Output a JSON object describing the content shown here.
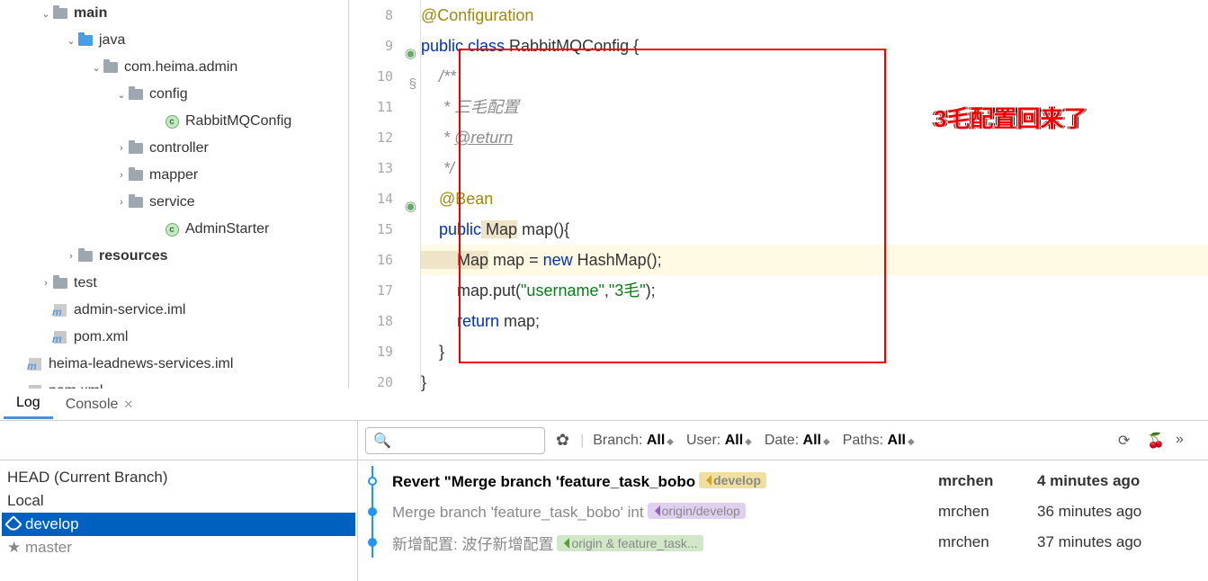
{
  "tree": [
    {
      "indent": 44,
      "arrow": "v",
      "icon": "folder",
      "label": "main",
      "bold": true
    },
    {
      "indent": 72,
      "arrow": "v",
      "icon": "folder-blue",
      "label": "java",
      "bold": false
    },
    {
      "indent": 100,
      "arrow": "v",
      "icon": "folder",
      "label": "com.heima.admin",
      "bold": false
    },
    {
      "indent": 128,
      "arrow": "v",
      "icon": "folder",
      "label": "config",
      "bold": false
    },
    {
      "indent": 168,
      "arrow": "",
      "icon": "class",
      "label": "RabbitMQConfig",
      "bold": false
    },
    {
      "indent": 128,
      "arrow": ">",
      "icon": "folder",
      "label": "controller",
      "bold": false
    },
    {
      "indent": 128,
      "arrow": ">",
      "icon": "folder",
      "label": "mapper",
      "bold": false
    },
    {
      "indent": 128,
      "arrow": ">",
      "icon": "folder",
      "label": "service",
      "bold": false
    },
    {
      "indent": 168,
      "arrow": "",
      "icon": "class-run",
      "label": "AdminStarter",
      "bold": false
    },
    {
      "indent": 72,
      "arrow": ">",
      "icon": "folder",
      "label": "resources",
      "bold": true
    },
    {
      "indent": 44,
      "arrow": ">",
      "icon": "folder",
      "label": "test",
      "bold": false
    },
    {
      "indent": 44,
      "arrow": "",
      "icon": "file",
      "label": "admin-service.iml",
      "bold": false
    },
    {
      "indent": 44,
      "arrow": "",
      "icon": "mfile",
      "label": "pom.xml",
      "bold": false
    },
    {
      "indent": 16,
      "arrow": "",
      "icon": "file",
      "label": "heima-leadnews-services.iml",
      "bold": false
    },
    {
      "indent": 16,
      "arrow": "",
      "icon": "mfile",
      "label": "pom.xml",
      "bold": false
    }
  ],
  "gutter": {
    "lines": [
      "8",
      "9",
      "10",
      "11",
      "12",
      "13",
      "14",
      "15",
      "16",
      "17",
      "18",
      "19",
      "20"
    ]
  },
  "code": {
    "l8": "@Configuration",
    "l9a": "public",
    "l9b": " class",
    "l9c": " RabbitMQConfig {",
    "l10": "    /**",
    "l11": "     * 三毛配置",
    "l12a": "     * ",
    "l12b": "@return",
    "l13": "     */",
    "l14": "    @Bean",
    "l15a": "    public",
    "l15b": " Map",
    "l15c": " map(){",
    "l16a": "        Map",
    "l16b": " map",
    "l16c": " = ",
    "l16d": "new",
    "l16e": " HashMap();",
    "l17a": "        map.put(",
    "l17b": "\"username\"",
    "l17c": ",",
    "l17d": "\"3毛\"",
    "l17e": ");",
    "l18a": "        return",
    "l18b": " map;",
    "l19": "    }",
    "l20": "}"
  },
  "annotation": "3毛配置回来了",
  "tabs": {
    "log": "Log",
    "console": "Console"
  },
  "branches": {
    "head": "HEAD (Current Branch)",
    "local": "Local",
    "develop": "develop",
    "master": "master"
  },
  "filter": {
    "branch_l": "Branch:",
    "branch_v": "All",
    "user_l": "User:",
    "user_v": "All",
    "date_l": "Date:",
    "date_v": "All",
    "paths_l": "Paths:",
    "paths_v": "All",
    "search_ph": ""
  },
  "log": [
    {
      "msg": "Revert \"Merge branch 'feature_task_bobo",
      "badge": "develop",
      "badgeClass": "yellow",
      "author": "mrchen",
      "time": "4 minutes ago",
      "bold": true,
      "dot": true
    },
    {
      "msg": "Merge branch 'feature_task_bobo' int",
      "badge": "origin/develop",
      "badgeClass": "purple",
      "author": "mrchen",
      "time": "36 minutes ago",
      "bold": false,
      "dot": true
    },
    {
      "msg": "新增配置: 波仔新增配置",
      "badge": "origin & feature_task...",
      "badgeClass": "green",
      "author": "mrchen",
      "time": "37 minutes ago",
      "bold": false,
      "dot": true
    }
  ],
  "more": "»"
}
